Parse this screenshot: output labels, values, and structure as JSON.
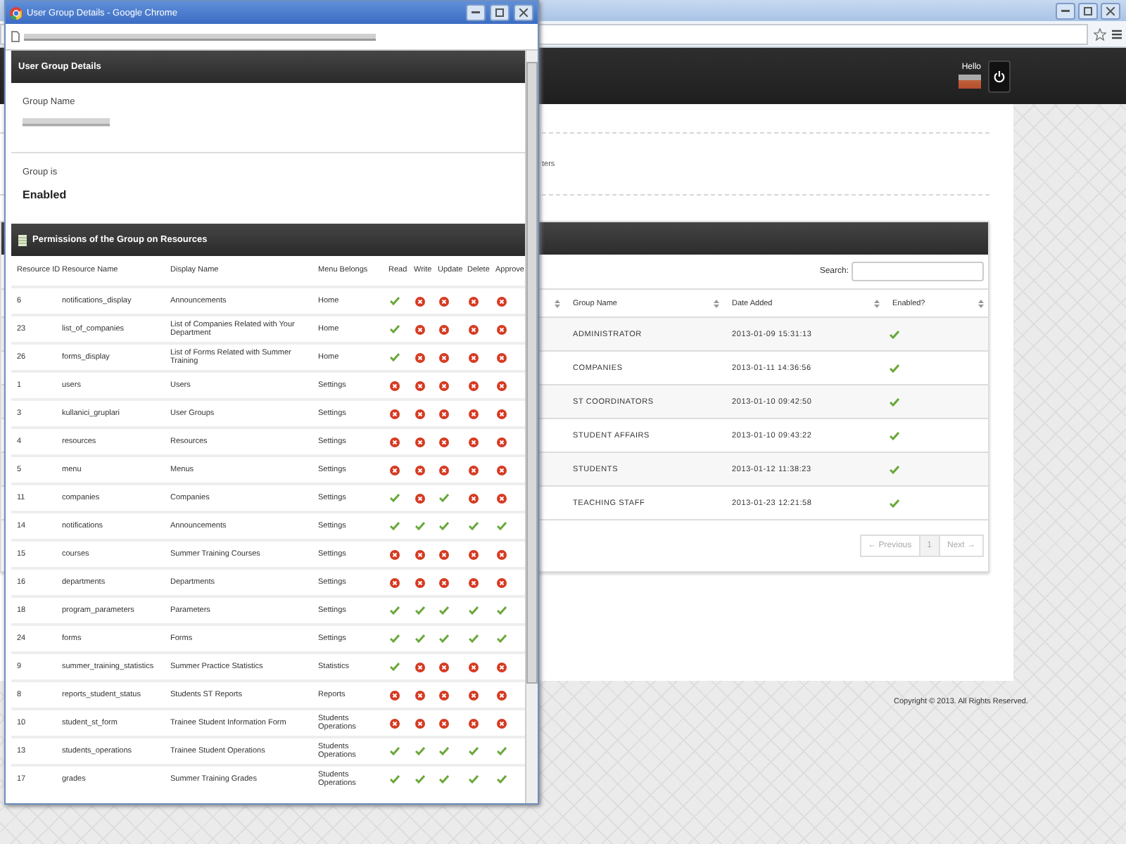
{
  "page": {
    "greeting": "Hello",
    "partial_text": "ters",
    "search_label": "Search:",
    "table": {
      "columns": [
        "Group Name",
        "Date Added",
        "Enabled?"
      ],
      "rows": [
        {
          "name": "ADMINISTRATOR",
          "date": "2013-01-09 15:31:13",
          "enabled": true
        },
        {
          "name": "COMPANIES",
          "date": "2013-01-11 14:36:56",
          "enabled": true
        },
        {
          "name": "ST COORDINATORS",
          "date": "2013-01-10 09:42:50",
          "enabled": true
        },
        {
          "name": "STUDENT AFFAIRS",
          "date": "2013-01-10 09:43:22",
          "enabled": true
        },
        {
          "name": "STUDENTS",
          "date": "2013-01-12 11:38:23",
          "enabled": true
        },
        {
          "name": "TEACHING STAFF",
          "date": "2013-01-23 12:21:58",
          "enabled": true
        }
      ]
    },
    "pagination": {
      "previous": {
        "label": "← Previous",
        "disabled": true
      },
      "pages": [
        {
          "label": "1",
          "selected": true
        }
      ],
      "next": {
        "label": "Next →",
        "disabled": true
      }
    },
    "footer": "Copyright © 2013. All Rights Reserved."
  },
  "popup": {
    "title": "User Group Details - Google Chrome",
    "panel_title": "User Group Details",
    "group_name_label": "Group Name",
    "group_status_label": "Group is",
    "group_status": "Enabled",
    "permissions_title": "Permissions of the Group on Resources",
    "columns": [
      "Resource ID",
      "Resource Name",
      "Display Name",
      "Menu Belongs",
      "Read",
      "Write",
      "Update",
      "Delete",
      "Approve"
    ],
    "rows": [
      {
        "id": "6",
        "resource": "notifications_display",
        "display": "Announcements",
        "menu": "Home",
        "read": true,
        "write": false,
        "update": false,
        "delete": false,
        "approve": false
      },
      {
        "id": "23",
        "resource": "list_of_companies",
        "display": "List of Companies Related with Your Department",
        "menu": "Home",
        "read": true,
        "write": false,
        "update": false,
        "delete": false,
        "approve": false
      },
      {
        "id": "26",
        "resource": "forms_display",
        "display": "List of Forms Related with Summer Training",
        "menu": "Home",
        "read": true,
        "write": false,
        "update": false,
        "delete": false,
        "approve": false
      },
      {
        "id": "1",
        "resource": "users",
        "display": "Users",
        "menu": "Settings",
        "read": false,
        "write": false,
        "update": false,
        "delete": false,
        "approve": false
      },
      {
        "id": "3",
        "resource": "kullanici_gruplari",
        "display": "User Groups",
        "menu": "Settings",
        "read": false,
        "write": false,
        "update": false,
        "delete": false,
        "approve": false
      },
      {
        "id": "4",
        "resource": "resources",
        "display": "Resources",
        "menu": "Settings",
        "read": false,
        "write": false,
        "update": false,
        "delete": false,
        "approve": false
      },
      {
        "id": "5",
        "resource": "menu",
        "display": "Menus",
        "menu": "Settings",
        "read": false,
        "write": false,
        "update": false,
        "delete": false,
        "approve": false
      },
      {
        "id": "11",
        "resource": "companies",
        "display": "Companies",
        "menu": "Settings",
        "read": true,
        "write": false,
        "update": true,
        "delete": false,
        "approve": false
      },
      {
        "id": "14",
        "resource": "notifications",
        "display": "Announcements",
        "menu": "Settings",
        "read": true,
        "write": true,
        "update": true,
        "delete": true,
        "approve": true
      },
      {
        "id": "15",
        "resource": "courses",
        "display": "Summer Training Courses",
        "menu": "Settings",
        "read": false,
        "write": false,
        "update": false,
        "delete": false,
        "approve": false
      },
      {
        "id": "16",
        "resource": "departments",
        "display": "Departments",
        "menu": "Settings",
        "read": false,
        "write": false,
        "update": false,
        "delete": false,
        "approve": false
      },
      {
        "id": "18",
        "resource": "program_parameters",
        "display": "Parameters",
        "menu": "Settings",
        "read": true,
        "write": true,
        "update": true,
        "delete": true,
        "approve": true
      },
      {
        "id": "24",
        "resource": "forms",
        "display": "Forms",
        "menu": "Settings",
        "read": true,
        "write": true,
        "update": true,
        "delete": true,
        "approve": true
      },
      {
        "id": "9",
        "resource": "summer_training_statistics",
        "display": "Summer Practice Statistics",
        "menu": "Statistics",
        "read": true,
        "write": false,
        "update": false,
        "delete": false,
        "approve": false
      },
      {
        "id": "8",
        "resource": "reports_student_status",
        "display": "Students ST Reports",
        "menu": "Reports",
        "read": false,
        "write": false,
        "update": false,
        "delete": false,
        "approve": false
      },
      {
        "id": "10",
        "resource": "student_st_form",
        "display": "Trainee Student Information Form",
        "menu": "Students Operations",
        "read": false,
        "write": false,
        "update": false,
        "delete": false,
        "approve": false
      },
      {
        "id": "13",
        "resource": "students_operations",
        "display": "Trainee Student Operations",
        "menu": "Students Operations",
        "read": true,
        "write": true,
        "update": true,
        "delete": true,
        "approve": true
      },
      {
        "id": "17",
        "resource": "grades",
        "display": "Summer Training Grades",
        "menu": "Students Operations",
        "read": true,
        "write": true,
        "update": true,
        "delete": true,
        "approve": true
      }
    ]
  }
}
